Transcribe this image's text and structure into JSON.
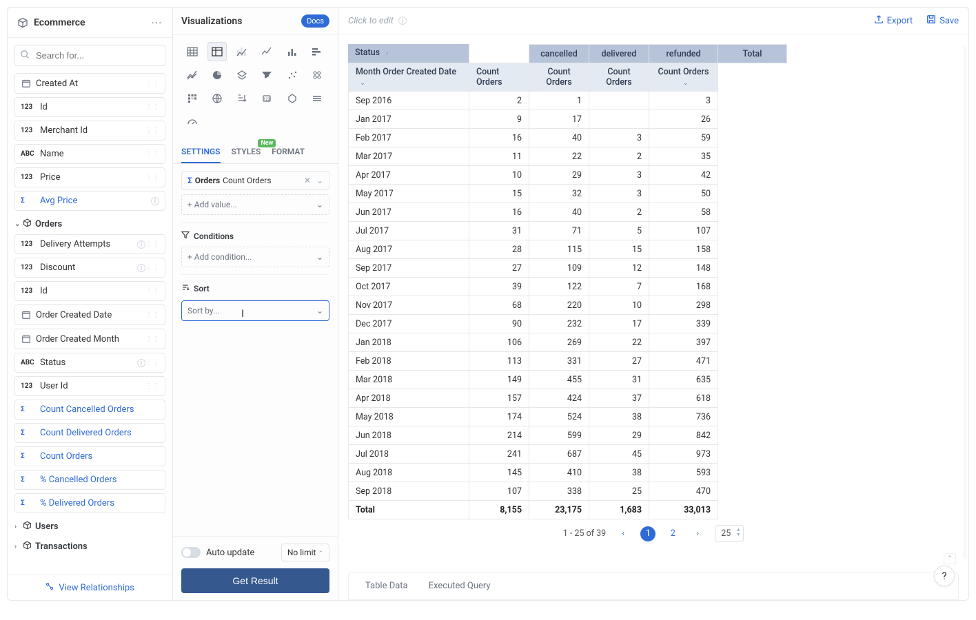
{
  "sidebar": {
    "title": "Ecommerce",
    "search_placeholder": "Search for...",
    "groups": [
      {
        "name": "",
        "fields": [
          {
            "type": "date",
            "label": "Created At"
          },
          {
            "type": "123",
            "label": "Id"
          },
          {
            "type": "123",
            "label": "Merchant Id"
          },
          {
            "type": "ABC",
            "label": "Name"
          },
          {
            "type": "123",
            "label": "Price"
          }
        ],
        "measures": [
          {
            "label": "Avg Price",
            "info": true
          }
        ]
      },
      {
        "name": "Orders",
        "fields": [
          {
            "type": "123",
            "label": "Delivery Attempts",
            "info": true
          },
          {
            "type": "123",
            "label": "Discount",
            "info": true
          },
          {
            "type": "123",
            "label": "Id"
          },
          {
            "type": "date",
            "label": "Order Created Date"
          },
          {
            "type": "date",
            "label": "Order Created Month"
          },
          {
            "type": "ABC",
            "label": "Status",
            "info": true
          },
          {
            "type": "123",
            "label": "User Id"
          }
        ],
        "measures": [
          {
            "label": "Count Cancelled Orders"
          },
          {
            "label": "Count Delivered Orders"
          },
          {
            "label": "Count Orders"
          },
          {
            "label": "% Cancelled Orders"
          },
          {
            "label": "% Delivered Orders"
          }
        ]
      },
      {
        "name": "Users",
        "collapsed": true
      },
      {
        "name": "Transactions",
        "collapsed": true
      }
    ],
    "view_relationships": "View Relationships"
  },
  "mid": {
    "title": "Visualizations",
    "docs": "Docs",
    "tabs": {
      "settings": "SETTINGS",
      "styles": "STYLES",
      "styles_badge": "New",
      "format": "FORMAT"
    },
    "value": {
      "prefix": "Orders",
      "label": "Count Orders"
    },
    "add_value": "+ Add value...",
    "conditions_title": "Conditions",
    "add_condition": "+ Add condition...",
    "sort_title": "Sort",
    "sort_placeholder": "Sort by...",
    "auto_update": "Auto update",
    "no_limit": "No limit",
    "get_result": "Get Result"
  },
  "main": {
    "click_to_edit": "Click to edit",
    "export": "Export",
    "save": "Save",
    "status_header": "Status",
    "month_header": "Month Order Created Date",
    "status_cols": [
      "cancelled",
      "delivered",
      "refunded",
      "Total"
    ],
    "count_label": "Count Orders",
    "pagination": {
      "info": "1 - 25 of 39",
      "current": "1",
      "next": "2",
      "page_size": "25"
    },
    "bottom_tabs": [
      "Table Data",
      "Executed Query"
    ]
  },
  "chart_data": {
    "type": "table",
    "columns": [
      "Month Order Created Date",
      "cancelled",
      "delivered",
      "refunded",
      "Total"
    ],
    "rows": [
      [
        "Sep 2016",
        "2",
        "1",
        "",
        "3"
      ],
      [
        "Jan 2017",
        "9",
        "17",
        "",
        "26"
      ],
      [
        "Feb 2017",
        "16",
        "40",
        "3",
        "59"
      ],
      [
        "Mar 2017",
        "11",
        "22",
        "2",
        "35"
      ],
      [
        "Apr 2017",
        "10",
        "29",
        "3",
        "42"
      ],
      [
        "May 2017",
        "15",
        "32",
        "3",
        "50"
      ],
      [
        "Jun 2017",
        "16",
        "40",
        "2",
        "58"
      ],
      [
        "Jul 2017",
        "31",
        "71",
        "5",
        "107"
      ],
      [
        "Aug 2017",
        "28",
        "115",
        "15",
        "158"
      ],
      [
        "Sep 2017",
        "27",
        "109",
        "12",
        "148"
      ],
      [
        "Oct 2017",
        "39",
        "122",
        "7",
        "168"
      ],
      [
        "Nov 2017",
        "68",
        "220",
        "10",
        "298"
      ],
      [
        "Dec 2017",
        "90",
        "232",
        "17",
        "339"
      ],
      [
        "Jan 2018",
        "106",
        "269",
        "22",
        "397"
      ],
      [
        "Feb 2018",
        "113",
        "331",
        "27",
        "471"
      ],
      [
        "Mar 2018",
        "149",
        "455",
        "31",
        "635"
      ],
      [
        "Apr 2018",
        "157",
        "424",
        "37",
        "618"
      ],
      [
        "May 2018",
        "174",
        "524",
        "38",
        "736"
      ],
      [
        "Jun 2018",
        "214",
        "599",
        "29",
        "842"
      ],
      [
        "Jul 2018",
        "241",
        "687",
        "45",
        "973"
      ],
      [
        "Aug 2018",
        "145",
        "410",
        "38",
        "593"
      ],
      [
        "Sep 2018",
        "107",
        "338",
        "25",
        "470"
      ]
    ],
    "totals": [
      "Total",
      "8,155",
      "23,175",
      "1,683",
      "33,013"
    ]
  }
}
